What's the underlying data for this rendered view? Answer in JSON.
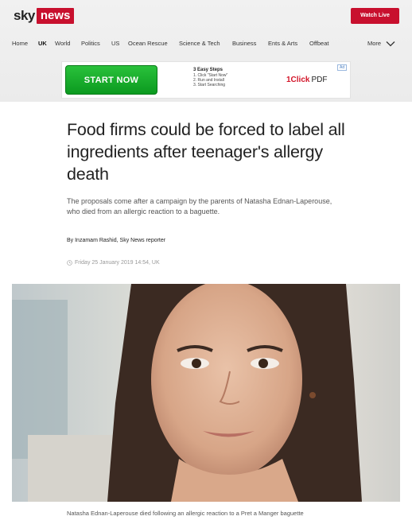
{
  "header": {
    "logo_sky": "sky",
    "logo_news": "news",
    "watch_live": "Watch Live",
    "brand_color": "#c8102e"
  },
  "nav": {
    "items": [
      "Home",
      "UK",
      "World",
      "Politics",
      "US",
      "Ocean Rescue",
      "Science & Tech",
      "Business",
      "Ents & Arts",
      "Offbeat"
    ],
    "active": "UK",
    "more": "More"
  },
  "ad": {
    "button": "START NOW",
    "steps_title": "3 Easy Steps",
    "steps": [
      "1. Click \"Start Now\"",
      "2. Run and Install",
      "3. Start Searching"
    ],
    "brand_mark": "1Click",
    "brand_text": "PDF",
    "tag": "Ad"
  },
  "article": {
    "headline": "Food firms could be forced to label all ingredients after teenager's allergy death",
    "standfirst": "The proposals come after a campaign by the parents of Natasha Ednan-Laperouse, who died from an allergic reaction to a baguette.",
    "byline_author": "By Inzamam Rashid",
    "byline_role": ", Sky News reporter",
    "date": "Friday 25 January 2019 14:54, UK",
    "caption": "Natasha Ednan-Laperouse died following an allergic reaction to a Pret a Manger baguette"
  }
}
